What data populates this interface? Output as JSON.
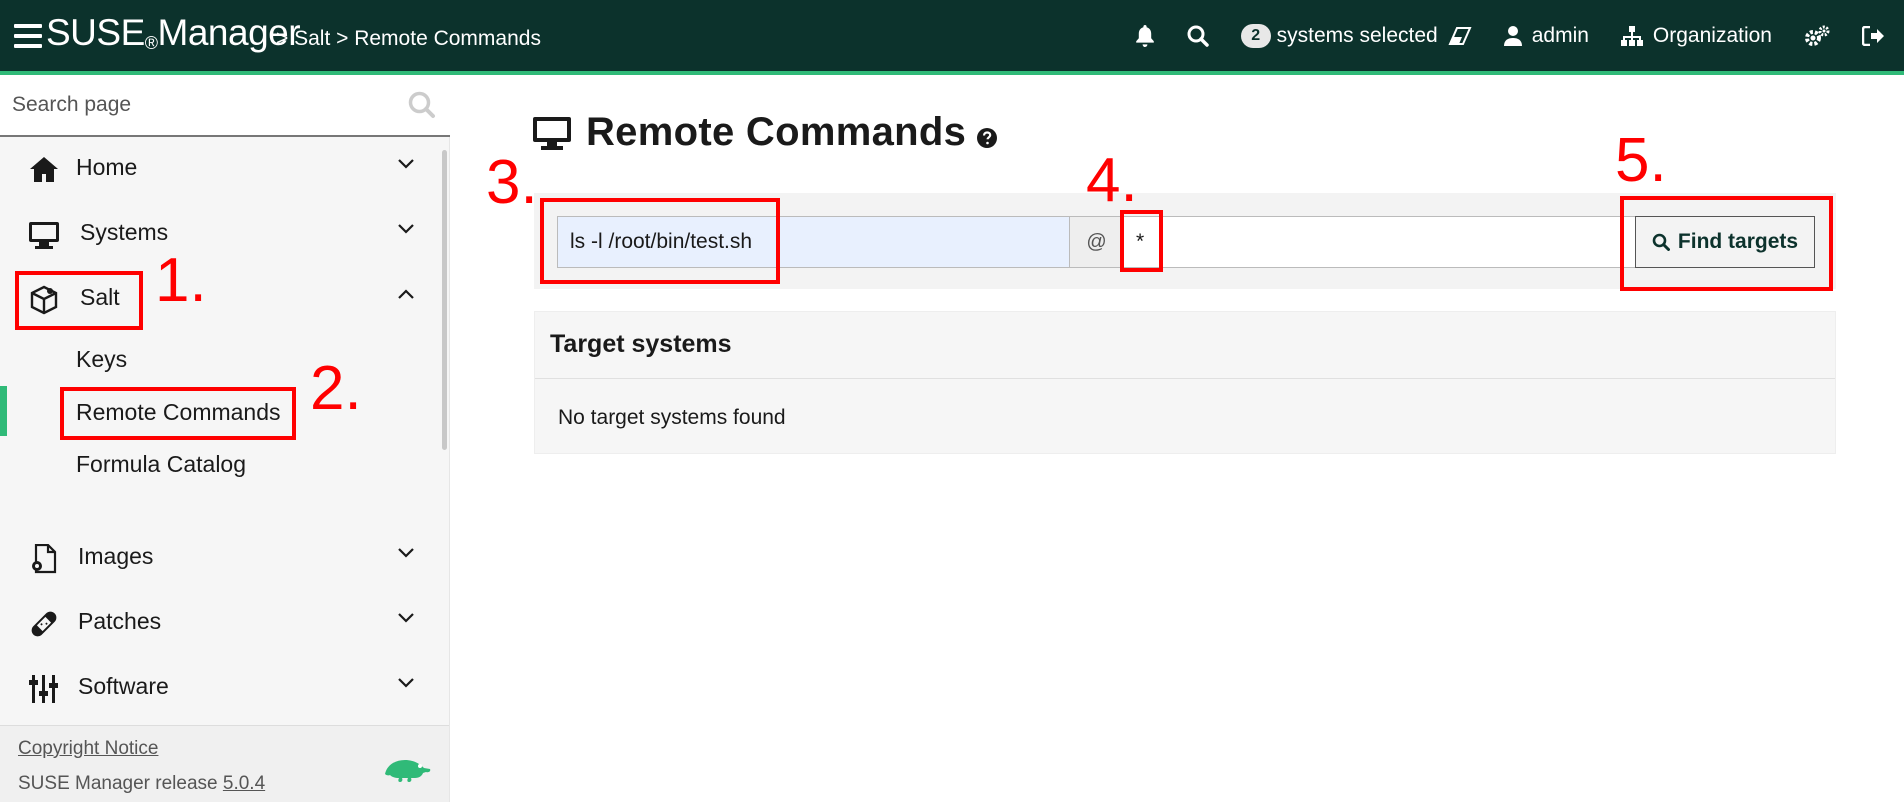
{
  "header": {
    "brand": "SUSE",
    "brand_reg": "®",
    "brand_product": "Manager",
    "breadcrumb": "> Salt > Remote Commands",
    "bell_icon": "bell-icon",
    "search_icon": "search-icon",
    "systems_count": "2",
    "systems_selected": "systems selected",
    "eraser_icon": "eraser-icon",
    "user_icon": "user-icon",
    "user": "admin",
    "org_icon": "sitemap-icon",
    "organization": "Organization",
    "settings_icon": "cogs-icon",
    "logout_icon": "sign-out-icon"
  },
  "sidebar": {
    "search_placeholder": "Search page",
    "items": [
      {
        "label": "Home",
        "icon": "home-icon",
        "expanded": false
      },
      {
        "label": "Systems",
        "icon": "desktop-icon",
        "expanded": false
      },
      {
        "label": "Salt",
        "icon": "salt-icon",
        "expanded": true
      },
      {
        "label": "Images",
        "icon": "file-cog-icon",
        "expanded": false
      },
      {
        "label": "Patches",
        "icon": "bandage-icon",
        "expanded": false
      },
      {
        "label": "Software",
        "icon": "sliders-icon",
        "expanded": false
      }
    ],
    "salt_subitems": [
      "Keys",
      "Remote Commands",
      "Formula Catalog"
    ],
    "active_subitem": "Remote Commands",
    "footer": {
      "copyright": "Copyright Notice",
      "release_prefix": "SUSE Manager release",
      "release_version": "5.0.4"
    }
  },
  "main": {
    "title": "Remote Commands",
    "title_icon": "desktop-icon",
    "help_icon": "question-circle-icon",
    "command_value": "ls -l /root/bin/test.sh",
    "at_symbol": "@",
    "target_value": "*",
    "find_button": "Find targets",
    "targets_title": "Target systems",
    "targets_empty": "No target systems found"
  },
  "annotations": [
    "1.",
    "2.",
    "3.",
    "4.",
    "5."
  ],
  "colors": {
    "header_bg": "#0c322c",
    "accent": "#30ba78",
    "annotation": "#ff0000"
  }
}
